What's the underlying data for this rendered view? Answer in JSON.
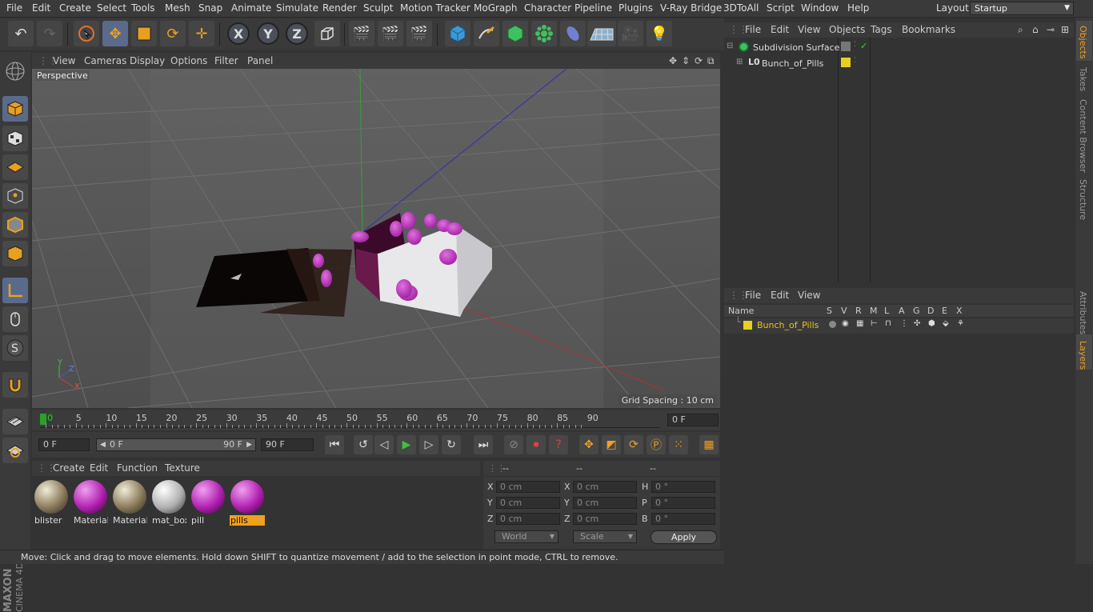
{
  "menubar": {
    "items": [
      "File",
      "Edit",
      "Create",
      "Select",
      "Tools",
      "Mesh",
      "Snap",
      "Animate",
      "Simulate",
      "Render",
      "Sculpt",
      "Motion Tracker",
      "MoGraph",
      "Character",
      "Pipeline",
      "Plugins",
      "V-Ray Bridge",
      "3DToAll",
      "Script",
      "Window",
      "Help"
    ],
    "layout_label": "Layout:",
    "layout_value": "Startup"
  },
  "toolbar": {
    "axis_x": "X",
    "axis_y": "Y",
    "axis_z": "Z"
  },
  "viewport": {
    "menu": [
      "View",
      "Cameras",
      "Display",
      "Options",
      "Filter",
      "Panel"
    ],
    "camera_label": "Perspective",
    "grid_spacing": "Grid Spacing : 10 cm",
    "axis_labels": {
      "x": "X",
      "y": "Y",
      "z": "Z"
    }
  },
  "timeline": {
    "ticks": [
      "0",
      "5",
      "10",
      "15",
      "20",
      "25",
      "30",
      "35",
      "40",
      "45",
      "50",
      "55",
      "60",
      "65",
      "70",
      "75",
      "80",
      "85",
      "90"
    ],
    "current_frame": "0 F"
  },
  "transport": {
    "start_field": "0 F",
    "range_start": "0 F",
    "range_end": "90 F",
    "end_field": "90 F"
  },
  "material_manager": {
    "menu": [
      "Create",
      "Edit",
      "Function",
      "Texture"
    ],
    "materials": [
      {
        "name": "blister",
        "type": "metal"
      },
      {
        "name": "Material",
        "type": "pink"
      },
      {
        "name": "Material",
        "type": "metal"
      },
      {
        "name": "mat_box",
        "type": "white"
      },
      {
        "name": "pill",
        "type": "pink"
      },
      {
        "name": "pills",
        "type": "pink",
        "selected": true
      }
    ]
  },
  "coordinates": {
    "headers": [
      "--",
      "--",
      "--"
    ],
    "pos_labels": [
      "X",
      "Y",
      "Z"
    ],
    "pos_values": [
      "0 cm",
      "0 cm",
      "0 cm"
    ],
    "size_labels": [
      "X",
      "Y",
      "Z"
    ],
    "size_values": [
      "0 cm",
      "0 cm",
      "0 cm"
    ],
    "rot_labels": [
      "H",
      "P",
      "B"
    ],
    "rot_values": [
      "0 °",
      "0 °",
      "0 °"
    ],
    "mode_world": "World",
    "mode_scale": "Scale",
    "apply": "Apply"
  },
  "status": "Move: Click and drag to move elements. Hold down SHIFT to quantize movement / add to the selection in point mode, CTRL to remove.",
  "object_manager": {
    "menu": [
      "File",
      "Edit",
      "View",
      "Objects",
      "Tags",
      "Bookmarks"
    ],
    "objects": [
      {
        "name": "Subdivision Surface"
      },
      {
        "name": "Bunch_of_Pills"
      }
    ]
  },
  "layer_manager": {
    "menu": [
      "File",
      "Edit",
      "View"
    ],
    "columns": [
      "Name",
      "S",
      "V",
      "R",
      "M",
      "L",
      "A",
      "G",
      "D",
      "E",
      "X"
    ],
    "layers": [
      {
        "name": "Bunch_of_Pills",
        "color": "#e8d020"
      }
    ]
  },
  "right_tabs": [
    "Objects",
    "Takes",
    "Content Browser",
    "Structure",
    "Attributes",
    "Layers"
  ],
  "brand": {
    "line1": "MAXON",
    "line2": "CINEMA 4D"
  }
}
